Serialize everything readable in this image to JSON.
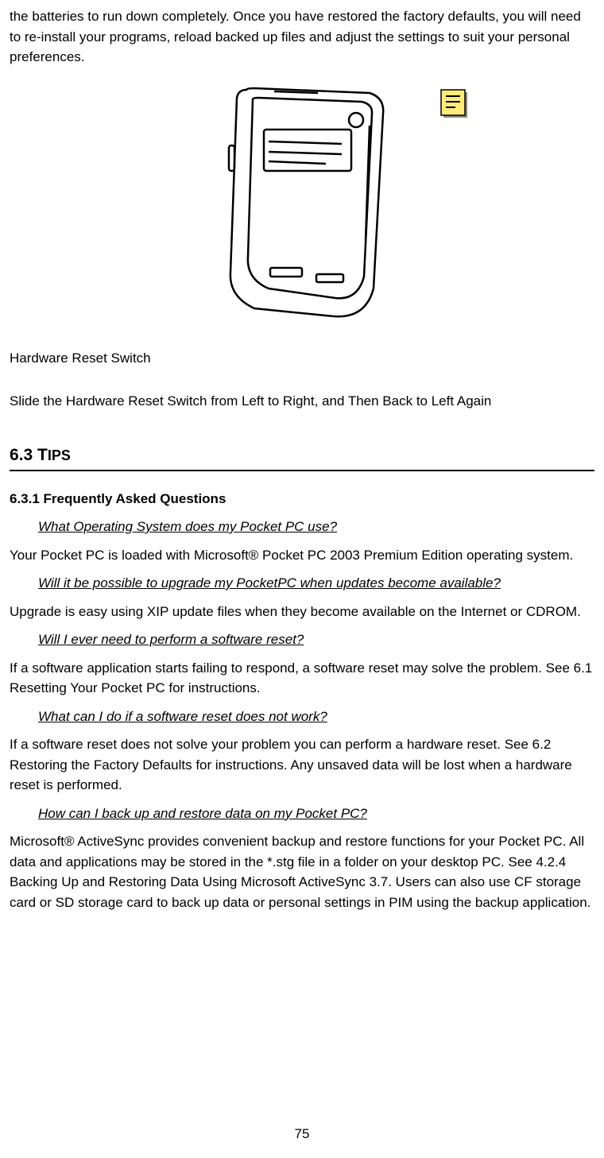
{
  "intro_paragraph": "the batteries to run down completely. Once you have restored the factory defaults, you will need to re-install your programs, reload backed up files and adjust the settings to suit your personal preferences.",
  "figure": {
    "caption": "Hardware Reset Switch",
    "instruction": "Slide the Hardware Reset Switch from Left to Right, and Then Back to Left Again"
  },
  "section": {
    "number": "6.3 ",
    "title_caps": "T",
    "title_small": "IPS",
    "subsection_heading": "6.3.1 Frequently Asked Questions",
    "faqs": [
      {
        "q": "What Operating System does my Pocket PC use?",
        "a": "Your Pocket PC is loaded with Microsoft® Pocket PC 2003 Premium Edition operating system."
      },
      {
        "q": "Will it be possible to upgrade my PocketPC when updates become available?",
        "a": "Upgrade is easy using XIP update files when they become available on the Internet or CDROM."
      },
      {
        "q": "Will I ever need to perform a software reset?",
        "a": "If a software application starts failing to respond, a software reset may solve the problem. See 6.1 Resetting Your Pocket PC for instructions."
      },
      {
        "q": "What can I do if a software reset does not work?",
        "a": "If a software reset does not solve your problem you can perform a hardware reset. See 6.2 Restoring the Factory Defaults for instructions. Any unsaved data will be lost when a hardware reset is performed."
      },
      {
        "q": "How can I back up and restore data on my Pocket PC?",
        "a": "Microsoft® ActiveSync provides convenient backup and restore functions for your Pocket PC. All data and applications may be stored in the *.stg file in a folder on your desktop PC. See 4.2.4 Backing Up and Restoring Data Using Microsoft ActiveSync 3.7. Users can also use CF storage card or SD storage card to back up data or personal settings in PIM using the backup application."
      }
    ]
  },
  "page_number": "75"
}
